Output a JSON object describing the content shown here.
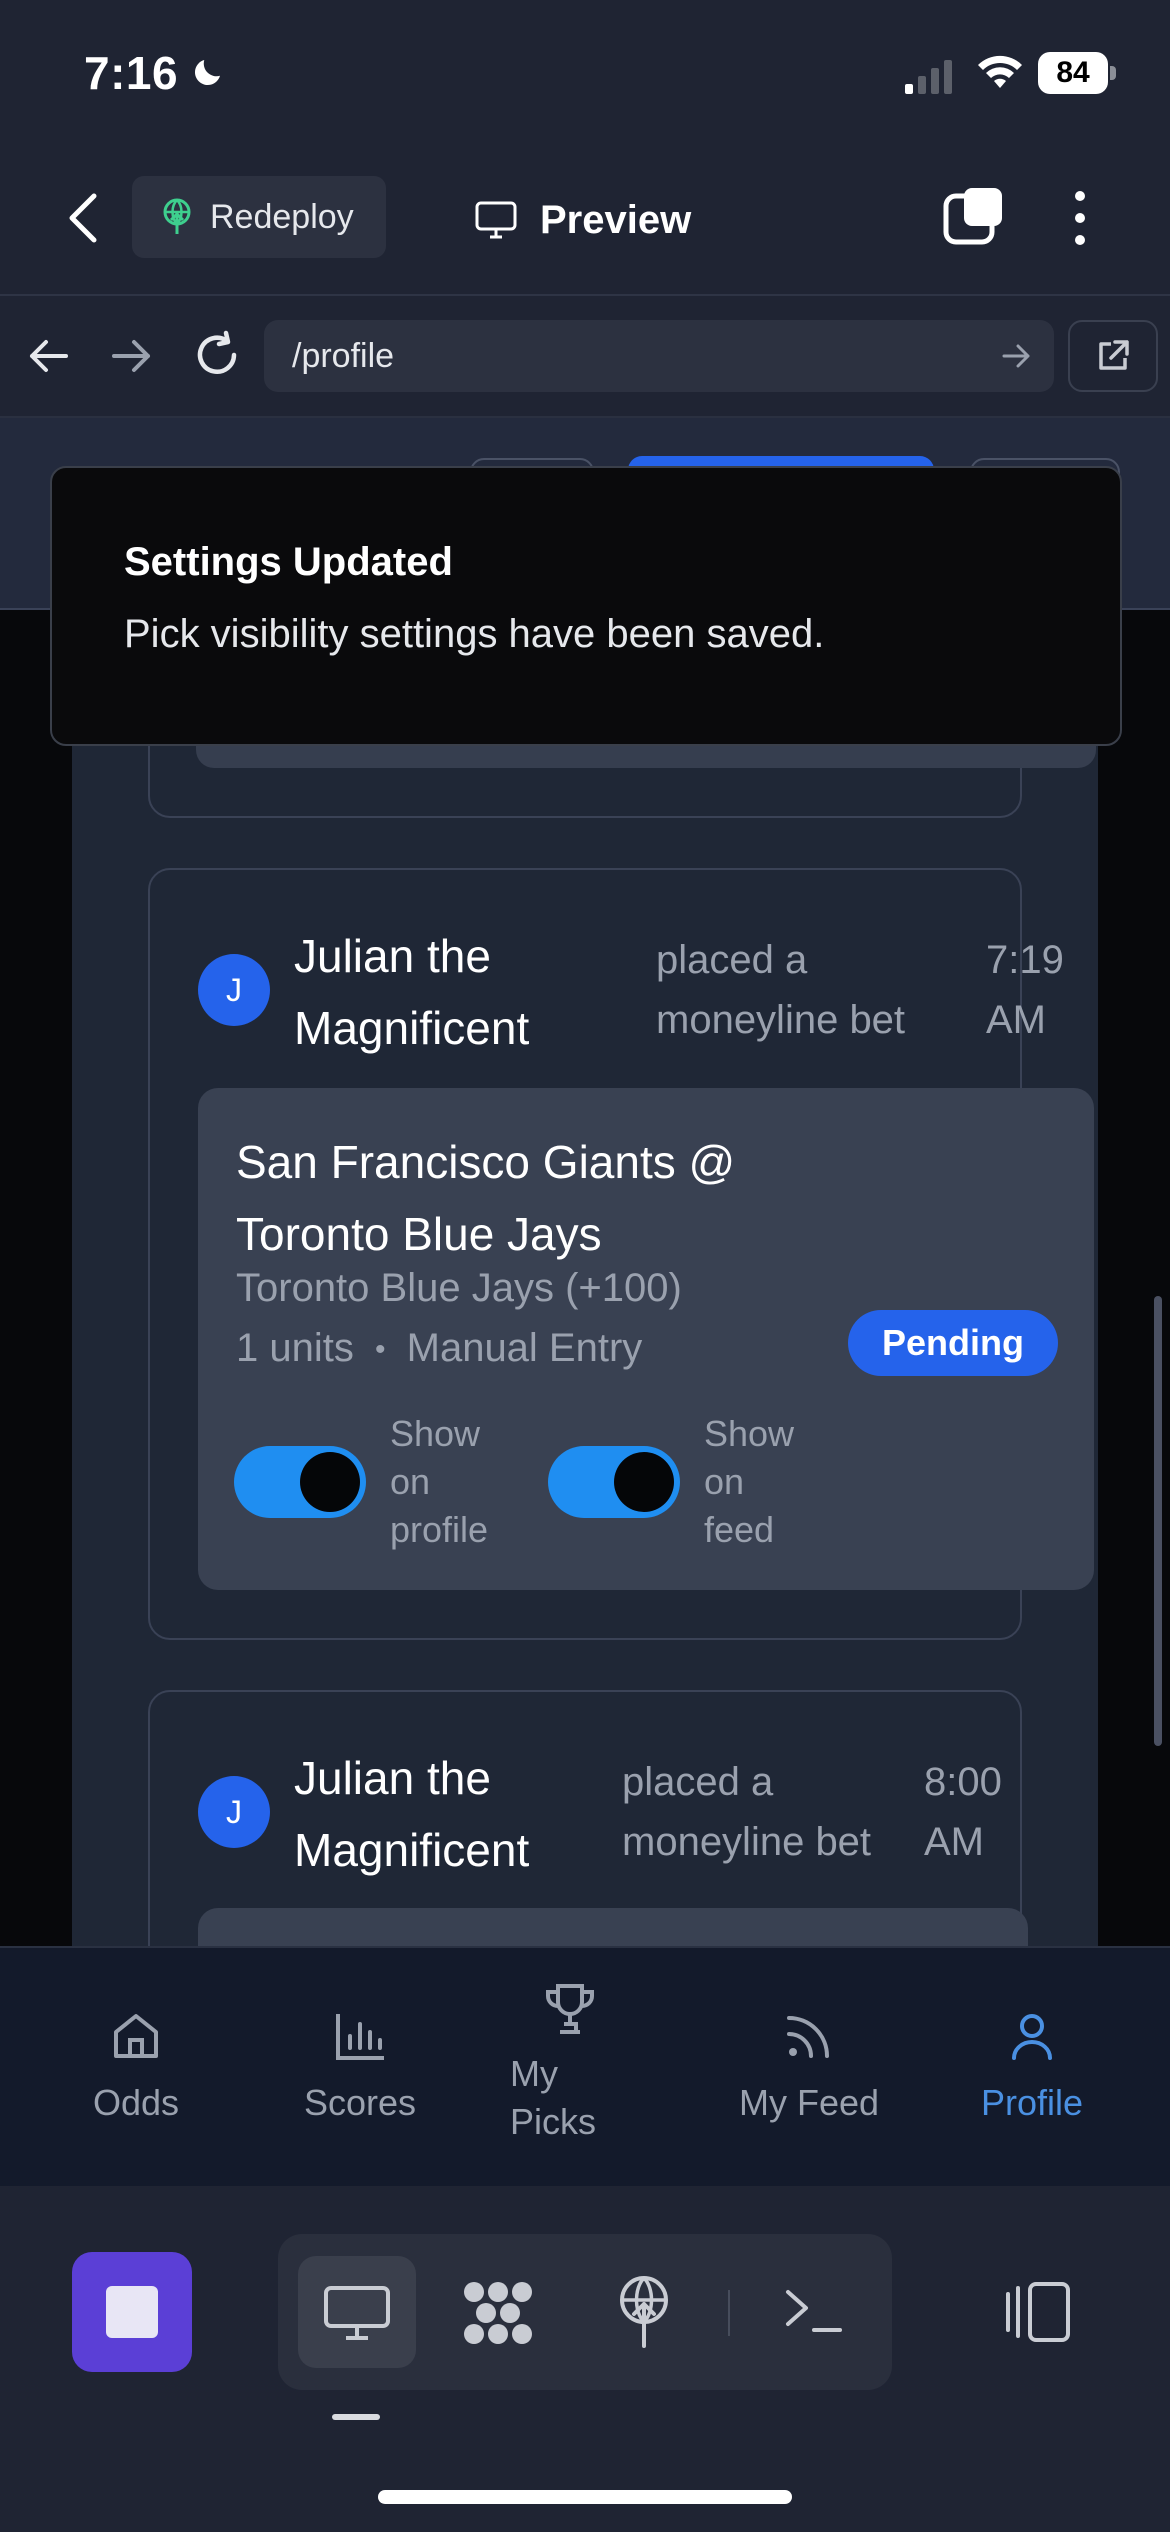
{
  "status_bar": {
    "time": "7:16",
    "battery": "84"
  },
  "header": {
    "redeploy_label": "Redeploy",
    "preview_label": "Preview"
  },
  "browser": {
    "url": "/profile"
  },
  "toast": {
    "title": "Settings Updated",
    "message": "Pick visibility settings have been saved."
  },
  "feed": {
    "items": [
      {
        "avatar_initial": "J",
        "user_name": "Julian the Magnificent",
        "action": "placed a moneyline bet",
        "time": "7:19 AM",
        "matchup": "San Francisco Giants @ Toronto Blue Jays",
        "pick": "Toronto Blue Jays (+100)",
        "units": "1 units",
        "separator": "•",
        "source": "Manual Entry",
        "status": "Pending",
        "toggle_profile_label": "Show on profile",
        "toggle_feed_label": "Show on feed",
        "show_on_profile": true,
        "show_on_feed": true
      },
      {
        "avatar_initial": "J",
        "user_name": "Julian the Magnificent",
        "action": "placed a moneyline bet",
        "time": "8:00 AM"
      }
    ]
  },
  "tabbar": {
    "items": [
      {
        "label": "Odds",
        "icon": "home-icon",
        "active": false
      },
      {
        "label": "Scores",
        "icon": "bar-chart-icon",
        "active": false
      },
      {
        "label": "My Picks",
        "icon": "trophy-icon",
        "active": false
      },
      {
        "label": "My Feed",
        "icon": "rss-icon",
        "active": false
      },
      {
        "label": "Profile",
        "icon": "user-icon",
        "active": true
      }
    ]
  },
  "colors": {
    "accent": "#2563eb",
    "toggle_on": "#1f8ef1",
    "active_tab": "#4a90e2",
    "stop_button": "#5b3fd6"
  }
}
